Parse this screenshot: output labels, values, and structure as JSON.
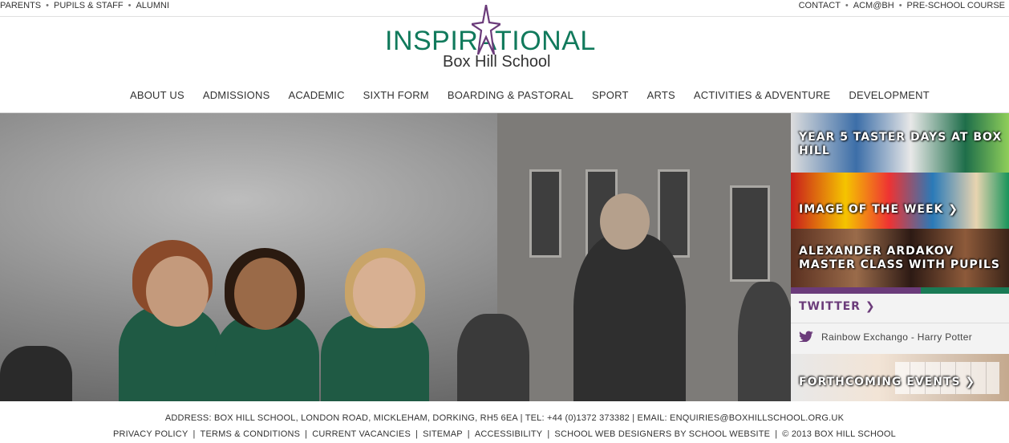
{
  "utility_left": [
    "PARENTS",
    "PUPILS & STAFF",
    "ALUMNI"
  ],
  "utility_right": [
    "CONTACT",
    "ACM@BH",
    "PRE-SCHOOL COURSE"
  ],
  "utility_separator": "•",
  "logo": {
    "word": "INSPIRATIONAL",
    "school": "Box Hill School",
    "brand_color": "#117a5c",
    "accent_color": "#6b3b7a"
  },
  "nav": [
    "ABOUT US",
    "ADMISSIONS",
    "ACADEMIC",
    "SIXTH FORM",
    "BOARDING & PASTORAL",
    "SPORT",
    "ARTS",
    "ACTIVITIES & ADVENTURE",
    "DEVELOPMENT"
  ],
  "sidebar": {
    "tile1": "YEAR 5 TASTER DAYS AT BOX HILL",
    "tile2": "IMAGE OF THE WEEK",
    "tile3": "ALEXANDER ARDAKOV MASTER CLASS WITH PUPILS",
    "twitter_heading": "TWITTER",
    "tweet": "Rainbow Exchango - Harry Potter",
    "tile4": "FORTHCOMING EVENTS",
    "chevron": "❯"
  },
  "footer": {
    "address": "ADDRESS: BOX HILL SCHOOL, LONDON ROAD, MICKLEHAM, DORKING, RH5 6EA  |  TEL: +44 (0)1372 373382  |  EMAIL: ENQUIRIES@BOXHILLSCHOOL.ORG.UK",
    "links": [
      "PRIVACY POLICY",
      "TERMS & CONDITIONS",
      "CURRENT VACANCIES",
      "SITEMAP",
      "ACCESSIBILITY",
      "SCHOOL WEB DESIGNERS BY SCHOOL WEBSITE",
      "© 2013 BOX HILL SCHOOL"
    ],
    "separator": "|"
  }
}
